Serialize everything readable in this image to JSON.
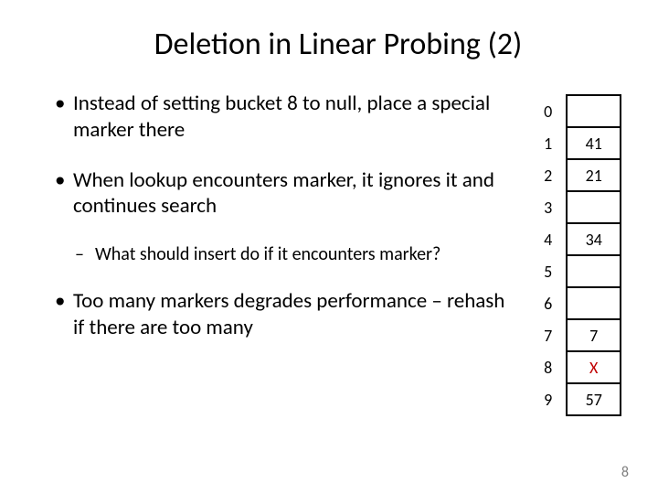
{
  "title": "Deletion in Linear Probing (2)",
  "bullets": {
    "b1": "Instead of setting bucket 8 to null, place a special marker there",
    "b2": "When lookup encounters marker, it ignores it and continues search",
    "b2sub": "What should insert do if it encounters marker?",
    "b3": "Too many markers degrades performance – rehash if there are too many"
  },
  "table": {
    "rows": [
      {
        "idx": "0",
        "val": ""
      },
      {
        "idx": "1",
        "val": "41"
      },
      {
        "idx": "2",
        "val": "21"
      },
      {
        "idx": "3",
        "val": ""
      },
      {
        "idx": "4",
        "val": "34"
      },
      {
        "idx": "5",
        "val": ""
      },
      {
        "idx": "6",
        "val": ""
      },
      {
        "idx": "7",
        "val": "7"
      },
      {
        "idx": "8",
        "val": "X",
        "marker": true
      },
      {
        "idx": "9",
        "val": "57"
      }
    ]
  },
  "page_number": "8"
}
